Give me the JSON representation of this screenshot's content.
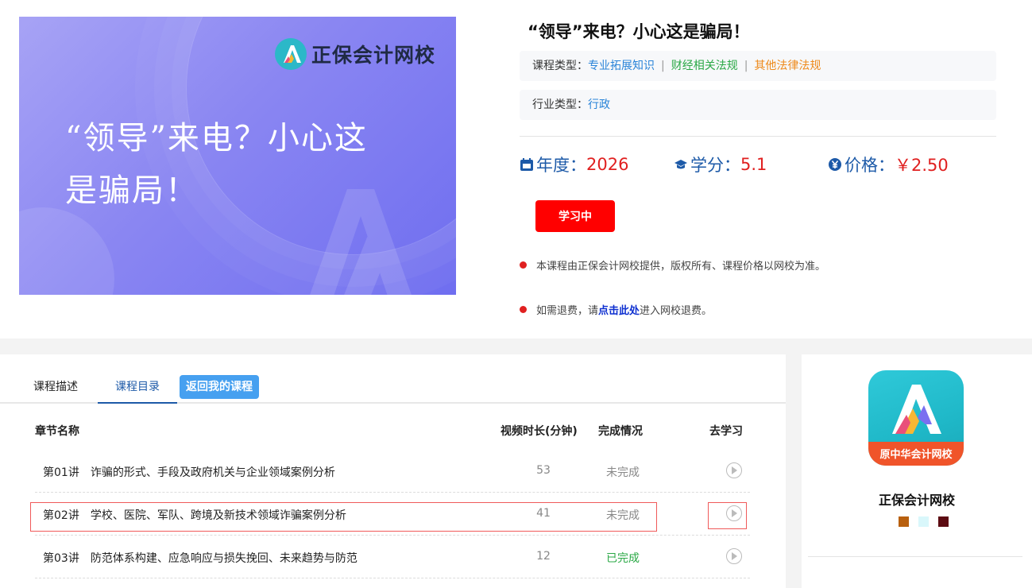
{
  "banner": {
    "brand": "正保会计网校",
    "title": "“领导”来电？小心这是骗局！"
  },
  "course": {
    "title": "“领导”来电？小心这是骗局！",
    "type_label": "课程类型：",
    "types": [
      "专业拓展知识",
      "财经相关法规",
      "其他法律法规"
    ],
    "type_sep": "|",
    "industry_label": "行业类型：",
    "industry": "行政",
    "year_label": "年度：",
    "year": "2026",
    "credit_label": "学分：",
    "credit": "5.1",
    "price_label": "价格：",
    "price": "￥2.50",
    "study_button": "学习中",
    "note1": "本课程由正保会计网校提供，版权所有、课程价格以网校为准。",
    "note2_prefix": "如需退费，请",
    "note2_link": "点击此处",
    "note2_suffix": "进入网校退费。"
  },
  "tabs": {
    "desc": "课程描述",
    "catalog": "课程目录",
    "back": "返回我的课程"
  },
  "table": {
    "headers": {
      "name": "章节名称",
      "duration": "视频时长(分钟)",
      "status": "完成情况",
      "go": "去学习"
    },
    "rows": [
      {
        "num": "第01讲",
        "title": "诈骗的形式、手段及政府机关与企业领域案例分析",
        "duration": "53",
        "status": "未完成"
      },
      {
        "num": "第02讲",
        "title": "学校、医院、军队、跨境及新技术领域诈骗案例分析",
        "duration": "41",
        "status": "未完成"
      },
      {
        "num": "第03讲",
        "title": "防范体系构建、应急响应与损失挽回、未来趋势与防范",
        "duration": "12",
        "status": "已完成"
      }
    ]
  },
  "side": {
    "app_stripe": "原中华会计网校",
    "name": "正保会计网校",
    "swatch_colors": [
      "#b8600f",
      "#d9f7fb",
      "#5c0b12"
    ]
  },
  "colors": {
    "accent_blue": "#1d5aa8",
    "price_red": "#e02020",
    "button_red": "#ff0000",
    "highlight_red": "#f05a5a"
  }
}
